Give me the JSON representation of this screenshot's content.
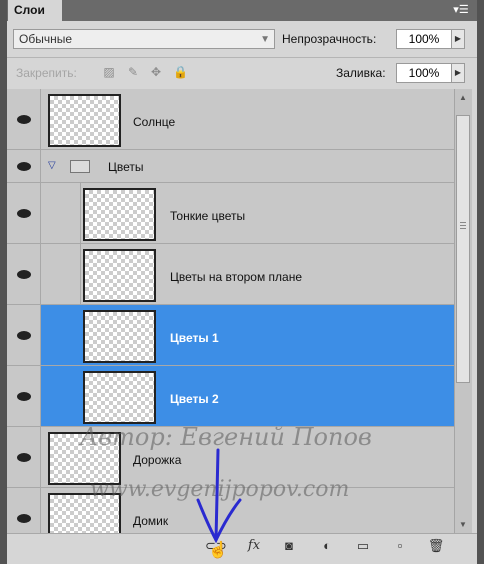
{
  "panel": {
    "tab_label": "Слои",
    "menu_icon": "panel-menu-icon"
  },
  "options": {
    "blend_mode": "Обычные",
    "opacity_label": "Непрозрачность:",
    "opacity_value": "100%",
    "lock_label": "Закрепить:",
    "fill_label": "Заливка:",
    "fill_value": "100%"
  },
  "layers": [
    {
      "name": "Солнце",
      "selected": false
    },
    {
      "name": "Цветы",
      "selected": false,
      "group": true
    },
    {
      "name": "Тонкие цветы",
      "selected": false
    },
    {
      "name": "Цветы на втором плане",
      "selected": false
    },
    {
      "name": "Цветы 1",
      "selected": true
    },
    {
      "name": "Цветы 2",
      "selected": true
    },
    {
      "name": "Дорожка",
      "selected": false
    },
    {
      "name": "Домик",
      "selected": false
    }
  ],
  "watermark": {
    "line1": "Автор: Евгений Попов",
    "line2": "www.evgenijpopov.com"
  },
  "bottom_icons": [
    "link-layers-icon",
    "fx-icon",
    "mask-icon",
    "adjustment-icon",
    "new-group-icon",
    "new-layer-icon",
    "delete-icon"
  ],
  "colors": {
    "selection": "#3d8ee6",
    "panel": "#d6d6d6",
    "annotation_arrow": "#2a2ad0"
  }
}
